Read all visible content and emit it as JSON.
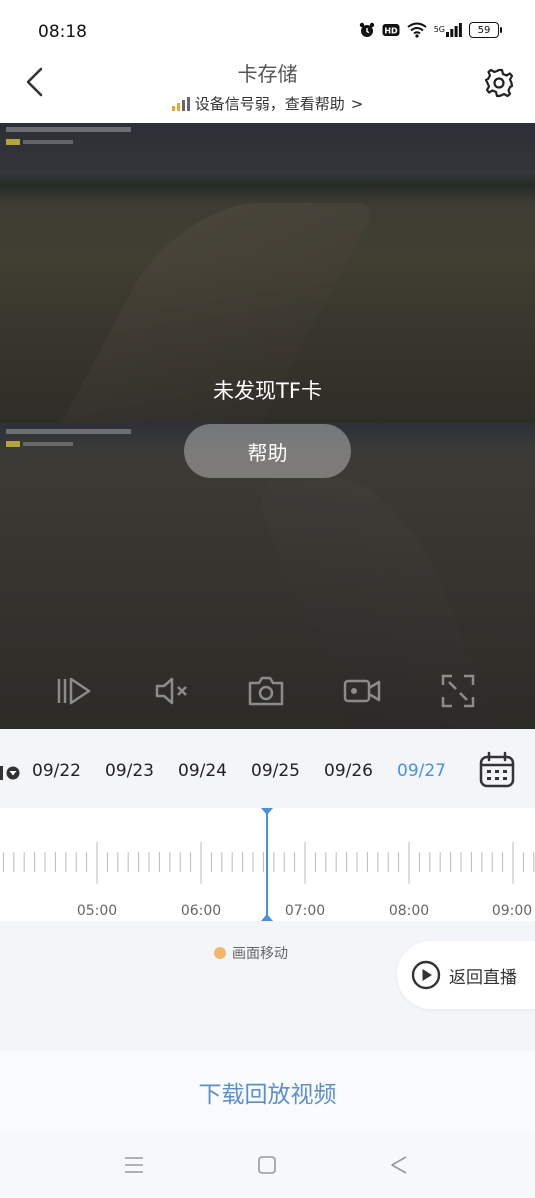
{
  "status": {
    "time": "08:18",
    "network": "5G",
    "battery": "59"
  },
  "header": {
    "title": "卡存储",
    "signal_hint": "设备信号弱，查看帮助",
    "signal_hint_chevron": ">"
  },
  "video": {
    "no_card_message": "未发现TF卡",
    "help_button": "帮助"
  },
  "dates": {
    "items": [
      "09/22",
      "09/23",
      "09/24",
      "09/25",
      "09/26",
      "09/27"
    ],
    "selected": "09/27"
  },
  "timeline": {
    "labels": [
      "05:00",
      "06:00",
      "07:00",
      "08:00",
      "09:00"
    ]
  },
  "events": {
    "legend_motion": "画面移动",
    "legend_color": "#f3b56b"
  },
  "live": {
    "label": "返回直播"
  },
  "download": {
    "label": "下载回放视频"
  },
  "colors": {
    "accent": "#4a90e2",
    "signal_weak": "#e8a62e"
  }
}
